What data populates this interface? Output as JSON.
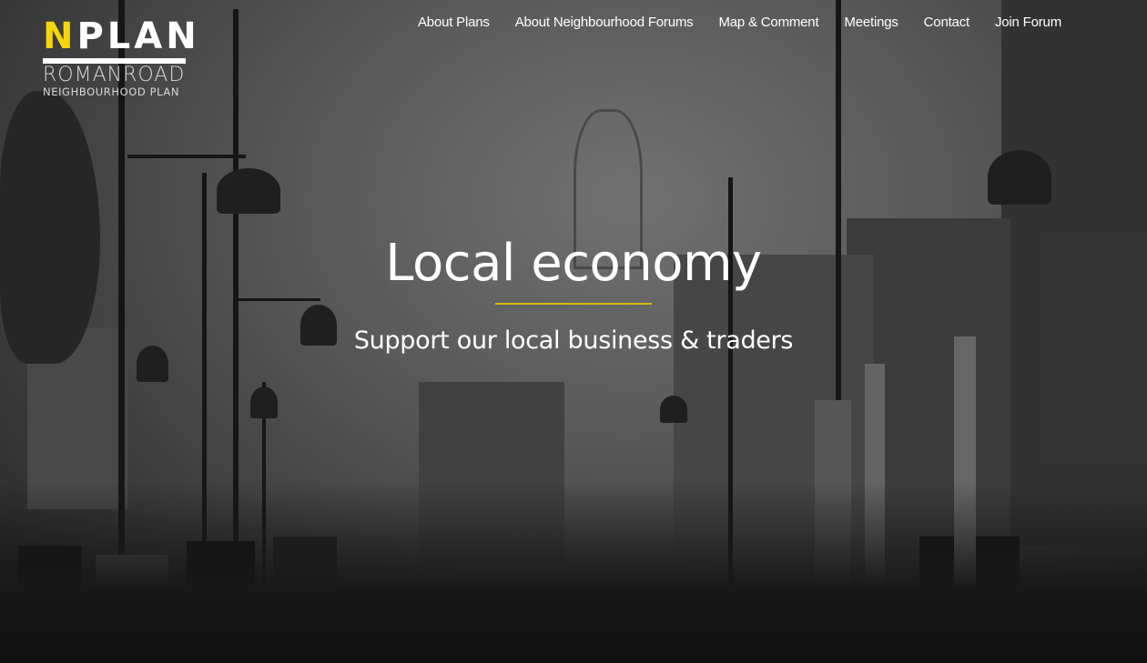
{
  "logo": {
    "first_letter": "N",
    "rest": "PLAN",
    "line1": "ROMANROAD",
    "line2": "NEIGHBOURHOOD PLAN",
    "accent_color": "#f5d60a"
  },
  "nav": {
    "items": [
      {
        "label": "About Plans"
      },
      {
        "label": "About Neighbourhood Forums"
      },
      {
        "label": "Map & Comment"
      },
      {
        "label": "Meetings"
      },
      {
        "label": "Contact"
      },
      {
        "label": "Join Forum"
      }
    ]
  },
  "hero": {
    "title": "Local economy",
    "subtitle": "Support our local business & traders",
    "divider_color": "#d8b914",
    "background": "black-and-white street market photo"
  }
}
